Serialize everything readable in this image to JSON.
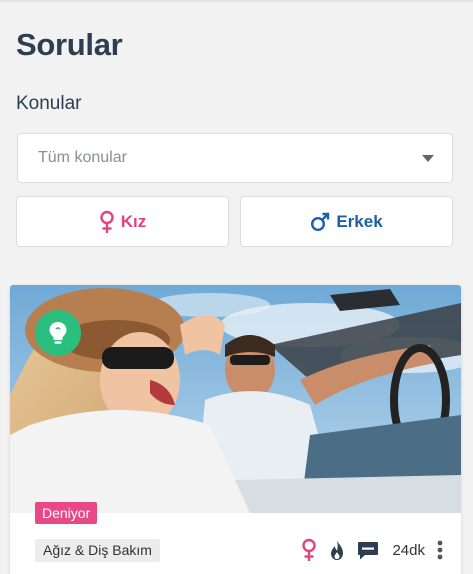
{
  "page": {
    "title": "Sorular",
    "topics_label": "Konular"
  },
  "topic_select": {
    "value": "Tüm konular"
  },
  "gender_filter": {
    "female_label": "Kız",
    "male_label": "Erkek"
  },
  "colors": {
    "brand_pink": "#e2427e",
    "brand_blue": "#1c5fa8",
    "success_green": "#2bbf7f",
    "heading": "#2c3e50"
  },
  "card": {
    "tag": "Deniyor",
    "category": "Ağız & Diş Bakım",
    "time": "24dk",
    "icons": [
      "lightbulb-icon",
      "female-icon",
      "flame-icon",
      "comment-icon",
      "more-vertical-icon"
    ]
  }
}
